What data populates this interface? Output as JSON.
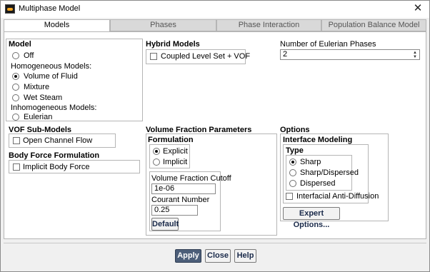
{
  "window": {
    "title": "Multiphase Model",
    "close_label": "✕"
  },
  "tabs": [
    {
      "label": "Models",
      "active": true
    },
    {
      "label": "Phases",
      "active": false
    },
    {
      "label": "Phase Interaction",
      "active": false
    },
    {
      "label": "Population Balance Model",
      "active": false
    }
  ],
  "model": {
    "heading": "Model",
    "off": "Off",
    "homogeneous_heading": "Homogeneous Models:",
    "volume_of_fluid": "Volume of Fluid",
    "mixture": "Mixture",
    "wet_steam": "Wet Steam",
    "inhomogeneous_heading": "Inhomogeneous Models:",
    "eulerian": "Eulerian",
    "selected": "Volume of Fluid"
  },
  "hybrid": {
    "heading": "Hybrid Models",
    "coupled_level_set": "Coupled Level Set + VOF",
    "coupled_checked": false
  },
  "eulerian_phases": {
    "label": "Number of Eulerian Phases",
    "value": "2"
  },
  "vof_sub_models": {
    "heading": "VOF Sub-Models",
    "open_channel_flow": "Open Channel Flow",
    "open_channel_checked": false
  },
  "body_force": {
    "heading": "Body Force Formulation",
    "implicit_body_force": "Implicit Body Force",
    "implicit_checked": false
  },
  "vf_params": {
    "heading": "Volume Fraction Parameters",
    "formulation_heading": "Formulation",
    "explicit": "Explicit",
    "implicit": "Implicit",
    "selected": "Explicit",
    "cutoff_label": "Volume Fraction Cutoff",
    "cutoff_value": "1e-06",
    "courant_label": "Courant Number",
    "courant_value": "0.25",
    "default_button": "Default"
  },
  "options": {
    "heading": "Options",
    "interface_heading": "Interface Modeling",
    "type_heading": "Type",
    "sharp": "Sharp",
    "sharp_dispersed": "Sharp/Dispersed",
    "dispersed": "Dispersed",
    "selected": "Sharp",
    "anti_diffusion": "Interfacial Anti-Diffusion",
    "anti_diffusion_checked": false,
    "expert_button": "Expert Options..."
  },
  "footer": {
    "apply": "Apply",
    "close": "Close",
    "help": "Help"
  },
  "colors": {
    "apply_button_bg": "#4c5e79",
    "panel_bg": "#ffffff",
    "window_bg": "#f0f0f0"
  }
}
